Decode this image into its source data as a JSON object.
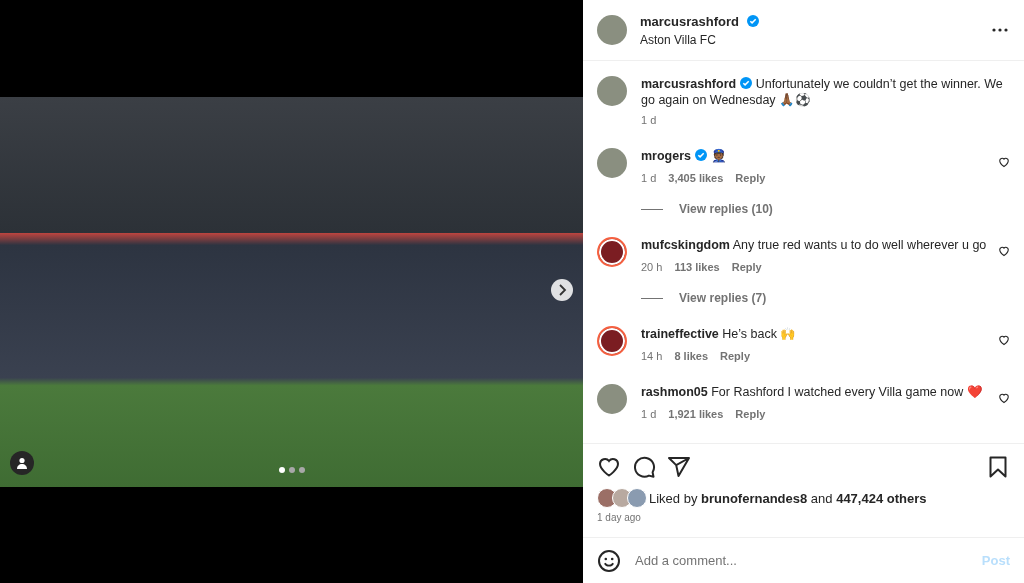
{
  "media": {
    "dots": [
      {
        "selected": true
      },
      {
        "selected": false
      },
      {
        "selected": false
      }
    ]
  },
  "header": {
    "username": "marcusrashford",
    "verified": true,
    "location": "Aston Villa FC"
  },
  "caption": {
    "username": "marcusrashford",
    "verified": true,
    "story_ring": false,
    "text": "Unfortunately we couldn’t get the winner. We go again on Wednesday 🙏🏾⚽",
    "time": "1 d"
  },
  "comments": [
    {
      "username": "mrogers",
      "verified": true,
      "story_ring": false,
      "text": "👮🏾",
      "time": "1 d",
      "likes": "3,405 likes",
      "reply": "Reply",
      "view_replies": "View replies (10)"
    },
    {
      "username": "mufcskingdom",
      "story_ring": true,
      "text": "Any true red wants u to do well wherever u go",
      "time": "20 h",
      "likes": "113 likes",
      "reply": "Reply",
      "view_replies": "View replies (7)"
    },
    {
      "username": "traineffective",
      "story_ring": true,
      "text": "He’s back 🙌",
      "time": "14 h",
      "likes": "8 likes",
      "reply": "Reply"
    },
    {
      "username": "rashmon05",
      "story_ring": false,
      "text": "For Rashford I watched every Villa game now ❤️",
      "time": "1 d",
      "likes": "1,921 likes",
      "reply": "Reply"
    }
  ],
  "likes": {
    "text": "Liked by **brunofernandes8** and **447,424 others**",
    "posted": "1 day ago"
  },
  "comment_box": {
    "placeholder": "Add a comment...",
    "post": "Post",
    "disabled": true
  }
}
